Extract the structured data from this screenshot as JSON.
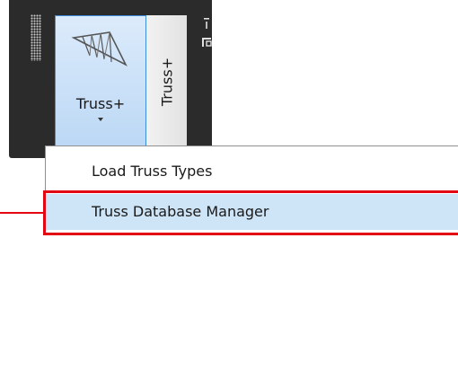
{
  "ribbon": {
    "button_label": "Truss+",
    "panel_title": "Truss+",
    "icons": {
      "button": "truss-icon",
      "grip": "panel-grip-icon",
      "controls": "panel-options-icon"
    }
  },
  "menu": {
    "items": [
      {
        "label": "Load Truss Types"
      },
      {
        "label": "Truss Database Manager"
      }
    ],
    "highlighted_index": 1
  },
  "colors": {
    "panel_background": "#2b2b2b",
    "button_pressed": "#bcd8f5",
    "button_border": "#3c8ddb",
    "menu_item_hover": "#cde5f7",
    "callout": "#e30613"
  }
}
